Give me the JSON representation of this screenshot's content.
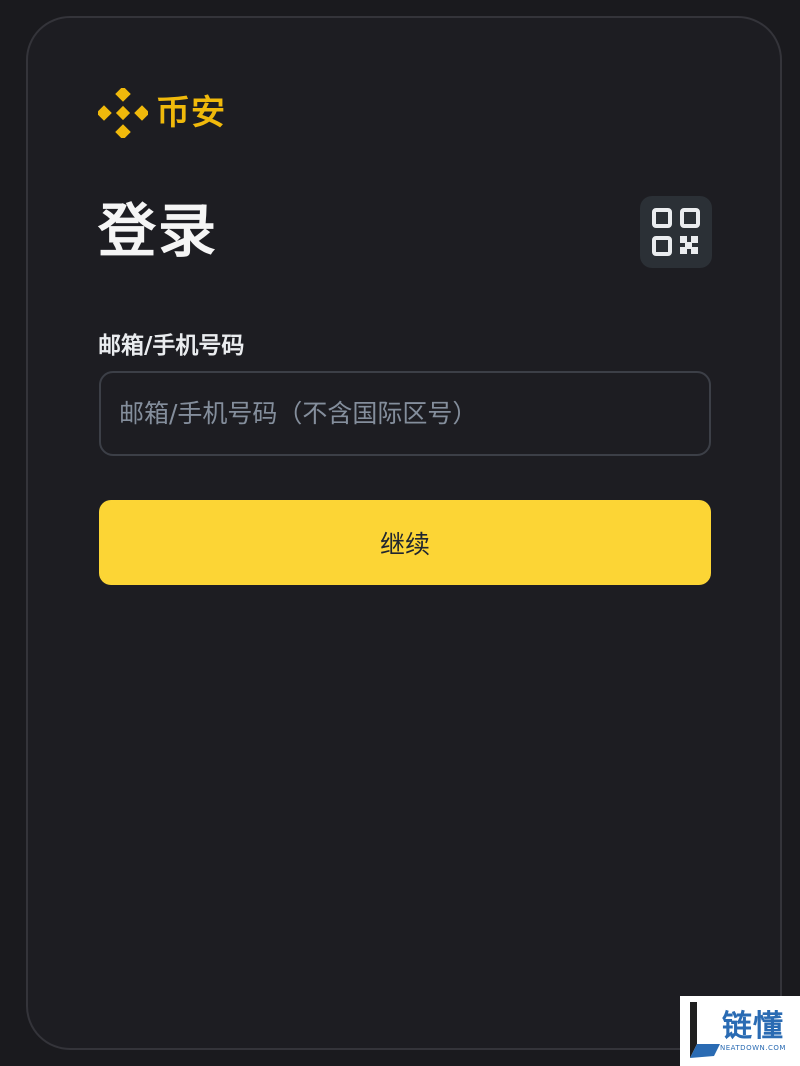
{
  "brand": {
    "name": "币安",
    "logo_icon": "binance-diamond-icon",
    "color": "#f0b90b"
  },
  "login": {
    "title": "登录",
    "qr_icon": "qr-code-icon",
    "field_label": "邮箱/手机号码",
    "field_value": "",
    "field_placeholder": "邮箱/手机号码（不含国际区号）",
    "continue_label": "继续",
    "continue_color": "#fcd535"
  },
  "watermark": {
    "name": "链懂",
    "domain": "NEATDOWN.COM",
    "color": "#2a6bb3"
  }
}
